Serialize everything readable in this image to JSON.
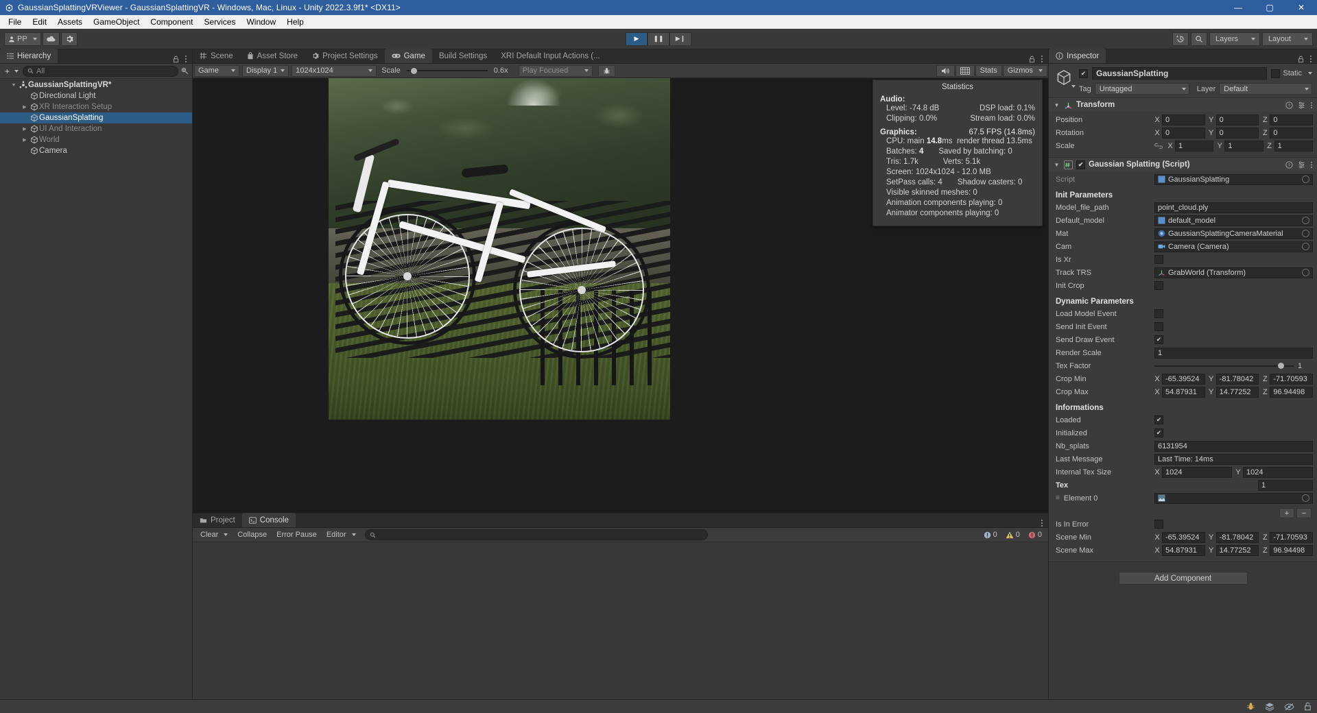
{
  "window": {
    "title": "GaussianSplattingVRViewer - GaussianSplattingVR - Windows, Mac, Linux - Unity 2022.3.9f1* <DX11>",
    "app_icon": "unity-icon",
    "minimize": "—",
    "maximize": "▢",
    "close": "✕"
  },
  "menubar": [
    "File",
    "Edit",
    "Assets",
    "GameObject",
    "Component",
    "Services",
    "Window",
    "Help"
  ],
  "toolbar": {
    "account_label": "PP",
    "cloud_icon": "cloud-icon",
    "settings_icon": "gear-icon",
    "play_icon": "▶",
    "pause_icon": "❚❚",
    "step_icon": "▶❙",
    "history_icon": "history-icon",
    "search_icon": "search-icon",
    "layers_label": "Layers",
    "layout_label": "Layout"
  },
  "hierarchy": {
    "tab_label": "Hierarchy",
    "tab_icon": "hierarchy-icon",
    "add_label": "+",
    "search_placeholder": "All",
    "items": [
      {
        "label": "GaussianSplattingVR*",
        "depth": 0,
        "arrow": "down",
        "selected": false,
        "dim": false,
        "root": true
      },
      {
        "label": "Directional Light",
        "depth": 1,
        "arrow": "none",
        "selected": false,
        "dim": false,
        "root": false
      },
      {
        "label": "XR Interaction Setup",
        "depth": 1,
        "arrow": "right",
        "selected": false,
        "dim": true,
        "root": false
      },
      {
        "label": "GaussianSplatting",
        "depth": 1,
        "arrow": "none",
        "selected": true,
        "dim": false,
        "root": false
      },
      {
        "label": "UI And Interaction",
        "depth": 1,
        "arrow": "right",
        "selected": false,
        "dim": true,
        "root": false
      },
      {
        "label": "World",
        "depth": 1,
        "arrow": "right",
        "selected": false,
        "dim": true,
        "root": false
      },
      {
        "label": "Camera",
        "depth": 1,
        "arrow": "none",
        "selected": false,
        "dim": false,
        "root": false
      }
    ]
  },
  "center_tabs": [
    {
      "label": "Scene",
      "icon": "scene-icon",
      "active": false
    },
    {
      "label": "Asset Store",
      "icon": "store-icon",
      "active": false
    },
    {
      "label": "Project Settings",
      "icon": "gear-icon",
      "active": false
    },
    {
      "label": "Game",
      "icon": "game-icon",
      "active": true
    },
    {
      "label": "Build Settings",
      "icon": "",
      "active": false
    },
    {
      "label": "XRI Default Input Actions (...",
      "icon": "",
      "active": false
    }
  ],
  "game_toolbar": {
    "display_mode": "Game",
    "display": "Display 1",
    "resolution": "1024x1024",
    "scale_label": "Scale",
    "scale_value": "0.6x",
    "play_focused": "Play Focused",
    "mute_icon": "speaker-icon",
    "grid_icon": "grid-icon",
    "stats_label": "Stats",
    "gizmos_label": "Gizmos",
    "bug_icon": "bug-icon"
  },
  "statistics": {
    "title": "Statistics",
    "audio_header": "Audio:",
    "audio_rows": [
      {
        "left": "Level: -74.8 dB",
        "right": "DSP load: 0.1%"
      },
      {
        "left": "Clipping: 0.0%",
        "right": "Stream load: 0.0%"
      }
    ],
    "graphics_header": "Graphics:",
    "fps": "67.5 FPS (14.8ms)",
    "cpu_label": "CPU: main",
    "cpu_main": "14.8",
    "cpu_main_unit": "ms",
    "render_thread": "render thread 13.5ms",
    "batches_label": "Batches:",
    "batches_value": "4",
    "saved_batching": "Saved by batching: 0",
    "tris": "Tris: 1.7k",
    "verts": "Verts: 5.1k",
    "screen": "Screen: 1024x1024 - 12.0 MB",
    "setpass_label": "SetPass calls: 4",
    "shadow_casters": "Shadow casters: 0",
    "visible_skinned": "Visible skinned meshes: 0",
    "animation_components": "Animation components playing: 0",
    "animator_components": "Animator components playing: 0"
  },
  "bottom_tabs": [
    {
      "label": "Project",
      "icon": "project-icon",
      "active": false
    },
    {
      "label": "Console",
      "icon": "console-icon",
      "active": true
    }
  ],
  "console_toolbar": {
    "clear": "Clear",
    "collapse": "Collapse",
    "error_pause": "Error Pause",
    "editor": "Editor",
    "search_placeholder": "",
    "counts": [
      {
        "icon": "log-icon",
        "value": "0"
      },
      {
        "icon": "warn-icon",
        "value": "0"
      },
      {
        "icon": "error-icon",
        "value": "0"
      }
    ]
  },
  "inspector": {
    "tab_label": "Inspector",
    "tab_icon": "info-icon",
    "object_name": "GaussianSplatting",
    "enabled": true,
    "static_label": "Static",
    "tag_label": "Tag",
    "tag_value": "Untagged",
    "layer_label": "Layer",
    "layer_value": "Default",
    "transform": {
      "title": "Transform",
      "icon": "transform-icon",
      "rows": [
        {
          "label": "Position",
          "x": "0",
          "y": "0",
          "z": "0"
        },
        {
          "label": "Rotation",
          "x": "0",
          "y": "0",
          "z": "0"
        },
        {
          "label": "Scale",
          "x": "1",
          "y": "1",
          "z": "1"
        }
      ],
      "scale_link_icon": "link-icon"
    },
    "script_component": {
      "title": "Gaussian Splatting (Script)",
      "enabled": true,
      "script_label": "Script",
      "script_value": "GaussianSplatting",
      "init_header": "Init Parameters",
      "init_rows": [
        {
          "label": "Model_file_path",
          "type": "text",
          "value": "point_cloud.ply"
        },
        {
          "label": "Default_model",
          "type": "obj",
          "value": "default_model",
          "icon": "asset-icon"
        },
        {
          "label": "Mat",
          "type": "obj",
          "value": "GaussianSplattingCameraMaterial",
          "icon": "material-icon"
        },
        {
          "label": "Cam",
          "type": "obj",
          "value": "Camera (Camera)",
          "icon": "camera-icon"
        },
        {
          "label": "Is Xr",
          "type": "check",
          "value": false
        },
        {
          "label": "Track TRS",
          "type": "obj",
          "value": "GrabWorld (Transform)",
          "icon": "transform-icon"
        },
        {
          "label": "Init Crop",
          "type": "check",
          "value": false
        }
      ],
      "dynamic_header": "Dynamic Parameters",
      "dynamic_rows": [
        {
          "label": "Load Model Event",
          "type": "check",
          "value": false
        },
        {
          "label": "Send Init Event",
          "type": "check",
          "value": false
        },
        {
          "label": "Send Draw Event",
          "type": "check",
          "value": true
        },
        {
          "label": "Render Scale",
          "type": "text",
          "value": "1"
        },
        {
          "label": "Tex Factor",
          "type": "slider",
          "value": "1"
        }
      ],
      "crop_min": {
        "label": "Crop Min",
        "x": "-65.39524",
        "y": "-81.78042",
        "z": "-71.70593"
      },
      "crop_max": {
        "label": "Crop Max",
        "x": "54.87931",
        "y": "14.77252",
        "z": "96.94498"
      },
      "info_header": "Informations",
      "info_rows": [
        {
          "label": "Loaded",
          "type": "check",
          "value": true
        },
        {
          "label": "Initialized",
          "type": "check",
          "value": true
        },
        {
          "label": "Nb_splats",
          "type": "text",
          "value": "6131954"
        },
        {
          "label": "Last Message",
          "type": "text",
          "value": "Last Time: 14ms"
        }
      ],
      "internal_tex_label": "Internal Tex Size",
      "internal_tex_x": "1024",
      "internal_tex_y": "1024",
      "tex_label": "Tex",
      "tex_size": "1",
      "tex_element_label": "Element 0",
      "tex_element_value": "",
      "array_add": "+",
      "array_remove": "−",
      "is_in_error": {
        "label": "Is In Error",
        "value": false
      },
      "scene_min": {
        "label": "Scene Min",
        "x": "-65.39524",
        "y": "-81.78042",
        "z": "-71.70593"
      },
      "scene_max": {
        "label": "Scene Max",
        "x": "54.87931",
        "y": "14.77252",
        "z": "96.94498"
      }
    },
    "add_component": "Add Component"
  },
  "statusbar": {
    "icons": [
      "bug-status-icon",
      "layers-status-icon",
      "eye-off-icon",
      "lock-icon"
    ]
  },
  "colors": {
    "accent_blue": "#2f5e9e",
    "selection": "#2c5d87",
    "panel_bg": "#383838",
    "toolbar_bg": "#393939"
  }
}
